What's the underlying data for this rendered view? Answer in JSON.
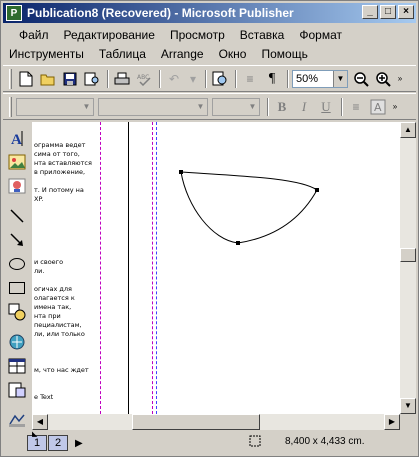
{
  "window": {
    "title": "Publication8 (Recovered) - Microsoft Publisher",
    "app_icon_letter": "P",
    "controls": [
      "minimize",
      "maximize",
      "close"
    ]
  },
  "menu": {
    "row1": [
      "Файл",
      "Редактирование",
      "Просмотр",
      "Вставка",
      "Формат"
    ],
    "row2": [
      "Инструменты",
      "Таблица",
      "Arrange",
      "Окно",
      "Помощь"
    ]
  },
  "standard_toolbar": {
    "zoom_value": "50%",
    "icons": [
      "new-icon",
      "open-icon",
      "save-icon",
      "search-icon",
      "print-icon",
      "spellcheck-icon",
      "undo-icon",
      "redo-icon",
      "print-preview-icon",
      "columns-icon",
      "paragraph-icon",
      "zoom-out-icon",
      "zoom-in-icon"
    ]
  },
  "format_toolbar": {
    "bold": "B",
    "italic": "I",
    "underline": "U"
  },
  "left_tools": [
    "text-frame-icon",
    "picture-frame-icon",
    "clip-art-icon",
    "line-icon",
    "arrow-icon",
    "oval-icon",
    "rectangle-icon",
    "autoshapes-icon",
    "hotspot-icon",
    "table-frame-icon",
    "wordart-icon",
    "object-icon"
  ],
  "document_text": [
    "ограмма ведет",
    "сима от того,",
    "нта вставляются",
    "в приложение,",
    "",
    "т. И потому на",
    "XP.",
    "",
    "",
    "",
    "",
    "",
    "",
    "и своего",
    "ли.",
    "",
    "огичах для",
    "олагается к",
    "имена так,",
    "нта при",
    "пециалистам,",
    "ли, или только",
    "",
    "",
    "",
    "м, что нас ждет",
    "",
    "",
    "е Text"
  ],
  "status": {
    "pages": [
      "1",
      "2"
    ],
    "active_page": "1",
    "position": "8,400 x    4,433 cm."
  },
  "colors": {
    "title_active": "#0a246a",
    "margin_guide": "#c000c0",
    "column_guide": "#4040ff",
    "face": "#d4d0c8"
  }
}
